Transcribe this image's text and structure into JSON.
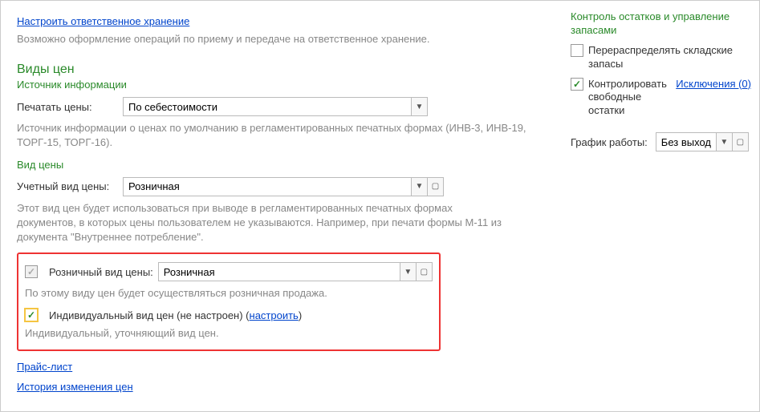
{
  "top": {
    "link_storage": "Настроить ответственное хранение",
    "desc_storage": "Возможно оформление операций по приему и передаче на ответственное хранение."
  },
  "prices": {
    "title": "Виды цен",
    "source_title": "Источник информации",
    "print_label": "Печатать цены:",
    "print_value": "По себестоимости",
    "source_desc": "Источник информации о ценах по умолчанию в регламентированных печатных формах (ИНВ-3, ИНВ-19, ТОРГ-15, ТОРГ-16).",
    "type_title": "Вид цены",
    "account_label": "Учетный вид цены:",
    "account_value": "Розничная",
    "account_desc": "Этот вид цен будет использоваться при выводе в регламентированных печатных формах документов, в которых цены пользователем не указываются. Например, при печати формы М-11 из документа \"Внутреннее потребление\".",
    "retail_label": "Розничный вид цены:",
    "retail_value": "Розничная",
    "retail_desc": "По этому виду цен будет осуществляться розничная продажа.",
    "individual_label_pre": "Индивидуальный вид цен (не настроен) (",
    "individual_link": "настроить",
    "individual_label_post": ")",
    "individual_desc": "Индивидуальный, уточняющий вид цен."
  },
  "links": {
    "pricelist": "Прайс-лист",
    "history": "История изменения цен"
  },
  "side": {
    "title": "Контроль остатков и управление запасами",
    "cb1_label": "Перераспределять складские запасы",
    "cb2_label": "Контролировать свободные остатки",
    "cb2_link": "Исключения (0)",
    "schedule_label": "График работы:",
    "schedule_value": "Без выход"
  }
}
